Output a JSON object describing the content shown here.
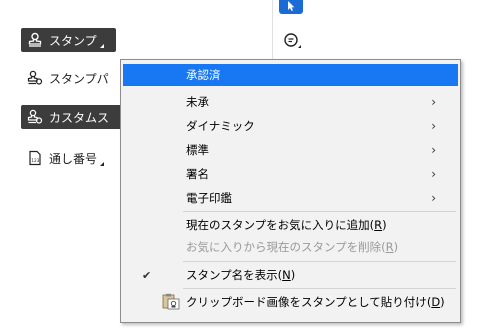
{
  "toolbar": {
    "stamp_label": "スタンプ",
    "stamp_palette_label": "スタンプパ",
    "custom_stamp_label": "カスタムス",
    "serial_number_label": "通し番号"
  },
  "menu": {
    "items": [
      {
        "label": "承認済"
      },
      {
        "label": "未承"
      },
      {
        "label": "ダイナミック"
      },
      {
        "label": "標準"
      },
      {
        "label": "署名"
      },
      {
        "label": "電子印鑑"
      }
    ],
    "add_favorite": {
      "label": "現在のスタンプをお気に入りに追加",
      "key": "R"
    },
    "remove_favorite": {
      "label": "お気に入りから現在のスタンプを削除",
      "key": "R"
    },
    "show_name": {
      "label": "スタンプ名を表示",
      "key": "N"
    },
    "paste_clipboard": {
      "label": "クリップボード画像をスタンプとして貼り付け",
      "key": "D"
    }
  },
  "colors": {
    "highlight": "#1877f2",
    "tool_dark": "#3c3c3c",
    "select_tool": "#1b6bd6"
  }
}
